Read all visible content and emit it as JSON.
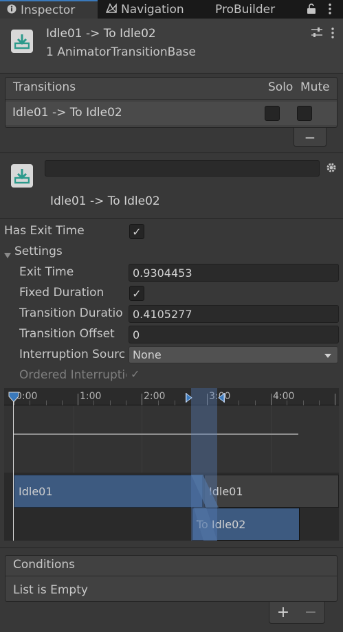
{
  "tabs": [
    {
      "label": "Inspector",
      "icon": "info-icon",
      "active": true
    },
    {
      "label": "Navigation",
      "icon": "navmesh-icon",
      "active": false
    },
    {
      "label": "ProBuilder",
      "icon": "",
      "active": false
    }
  ],
  "header": {
    "title": "Idle01 -> To Idle02",
    "subtitle": "1 AnimatorTransitionBase"
  },
  "transitions": {
    "heading": "Transitions",
    "solo_label": "Solo",
    "mute_label": "Mute",
    "rows": [
      {
        "name": "Idle01 -> To Idle02",
        "solo": false,
        "mute": false
      }
    ],
    "remove_label": "−"
  },
  "transition": {
    "name_value": "",
    "label": "Idle01 -> To Idle02"
  },
  "settings": {
    "has_exit_time_label": "Has Exit Time",
    "has_exit_time": true,
    "section_label": "Settings",
    "exit_time_label": "Exit Time",
    "exit_time_value": "0.9304453",
    "fixed_duration_label": "Fixed Duration",
    "fixed_duration": true,
    "transition_duration_label": "Transition Duratio",
    "transition_duration_value": "0.4105277",
    "transition_offset_label": "Transition Offset",
    "transition_offset_value": "0",
    "interruption_source_label": "Interruption Sourc",
    "interruption_source_value": "None",
    "ordered_interruption_label": "Ordered Interruptio",
    "ordered_interruption": true
  },
  "timeline": {
    "ticks": [
      "0:00",
      "1:00",
      "2:00",
      "3:00",
      "4:00"
    ],
    "source_clip": "Idle01",
    "source_clip_after": "Idle01",
    "dest_clip": "To Idle02"
  },
  "conditions": {
    "heading": "Conditions",
    "empty_text": "List is Empty",
    "add_label": "+",
    "remove_label": "−"
  },
  "colors": {
    "accent": "#3a79bb",
    "clip_blue": "#3d5a80",
    "panel": "#383838"
  }
}
